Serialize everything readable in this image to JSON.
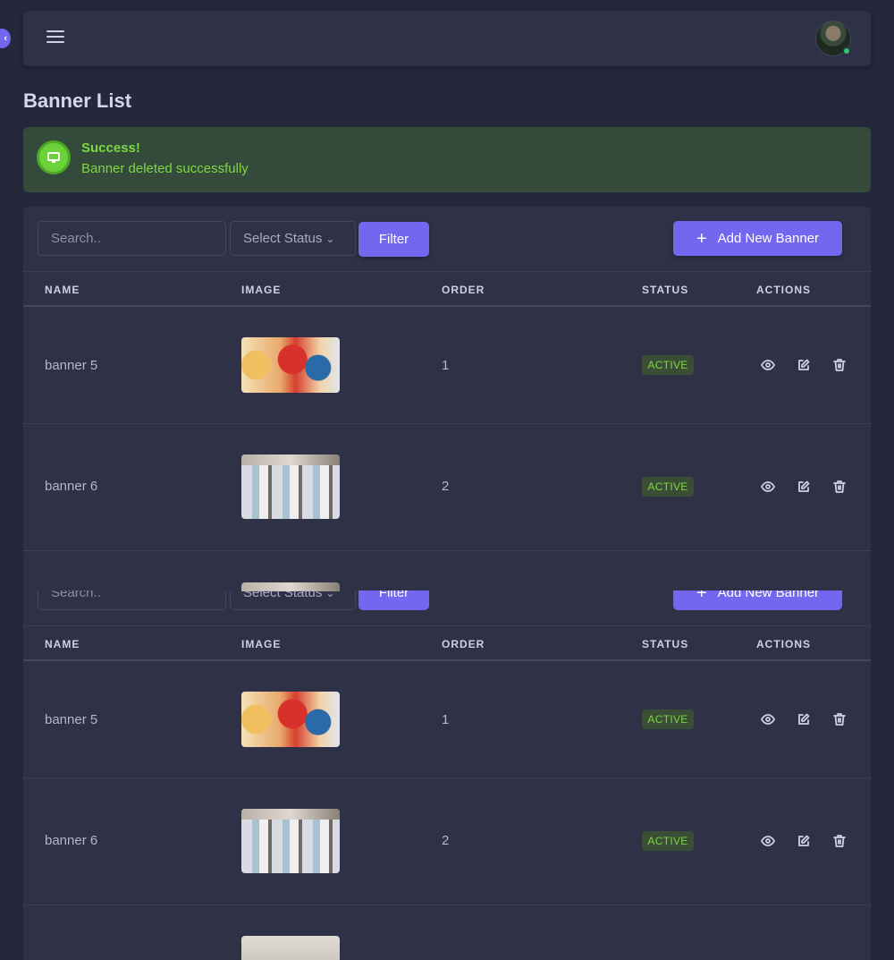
{
  "header": {
    "menu_icon": "hamburger-icon",
    "avatar_alt": "user-avatar",
    "status_color": "#28c76f"
  },
  "page": {
    "title": "Banner List"
  },
  "alert": {
    "title": "Success!",
    "message": "Banner deleted successfully",
    "icon": "monitor-icon",
    "color": "#7cd842"
  },
  "toolbar": {
    "search_placeholder": "Search..",
    "status_select": "Select Status",
    "filter_label": "Filter",
    "add_label": "Add New Banner"
  },
  "table": {
    "columns": [
      "NAME",
      "IMAGE",
      "ORDER",
      "STATUS",
      "ACTIONS"
    ],
    "rows": [
      {
        "name": "banner 5",
        "order": "1",
        "status": "ACTIVE"
      },
      {
        "name": "banner 6",
        "order": "2",
        "status": "ACTIVE"
      }
    ]
  },
  "colors": {
    "accent": "#7367f0",
    "background": "#25273a",
    "card": "#2f3147",
    "success_bg": "#344b3c"
  }
}
